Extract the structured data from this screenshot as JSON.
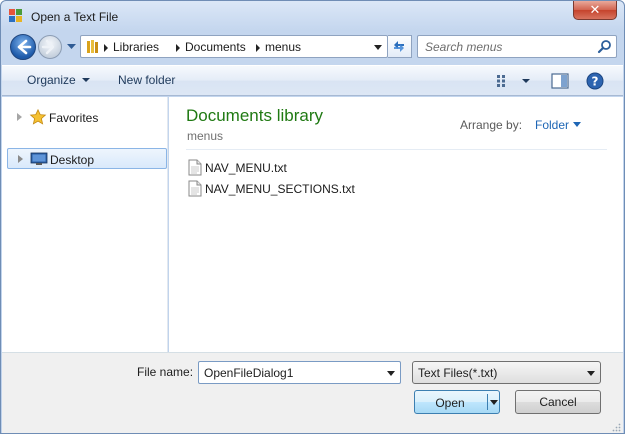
{
  "window": {
    "title": "Open a Text File",
    "close_label": "✕"
  },
  "address": {
    "crumbs": [
      "Libraries",
      "Documents",
      "menus"
    ],
    "search_placeholder": "Search menus"
  },
  "toolbar": {
    "organize_label": "Organize",
    "new_folder_label": "New folder"
  },
  "nav": {
    "items": [
      {
        "label": "Favorites",
        "icon": "star-icon"
      },
      {
        "label": "Desktop",
        "icon": "desktop-icon",
        "selected": true
      }
    ]
  },
  "content": {
    "library_title": "Documents library",
    "library_subtitle": "menus",
    "arrange_label": "Arrange by:",
    "arrange_value": "Folder",
    "files": [
      {
        "name": "NAV_MENU.txt",
        "icon": "text-file-icon"
      },
      {
        "name": "NAV_MENU_SECTIONS.txt",
        "icon": "text-file-icon"
      }
    ]
  },
  "footer": {
    "file_name_label": "File name:",
    "file_name_value": "OpenFileDialog1",
    "file_type_value": "Text Files(*.txt)",
    "open_label": "Open",
    "cancel_label": "Cancel"
  },
  "colors": {
    "library_title": "#207a13",
    "accent_link": "#1e66b5",
    "frame": "#bfd2eb",
    "close": "#c5432c"
  }
}
